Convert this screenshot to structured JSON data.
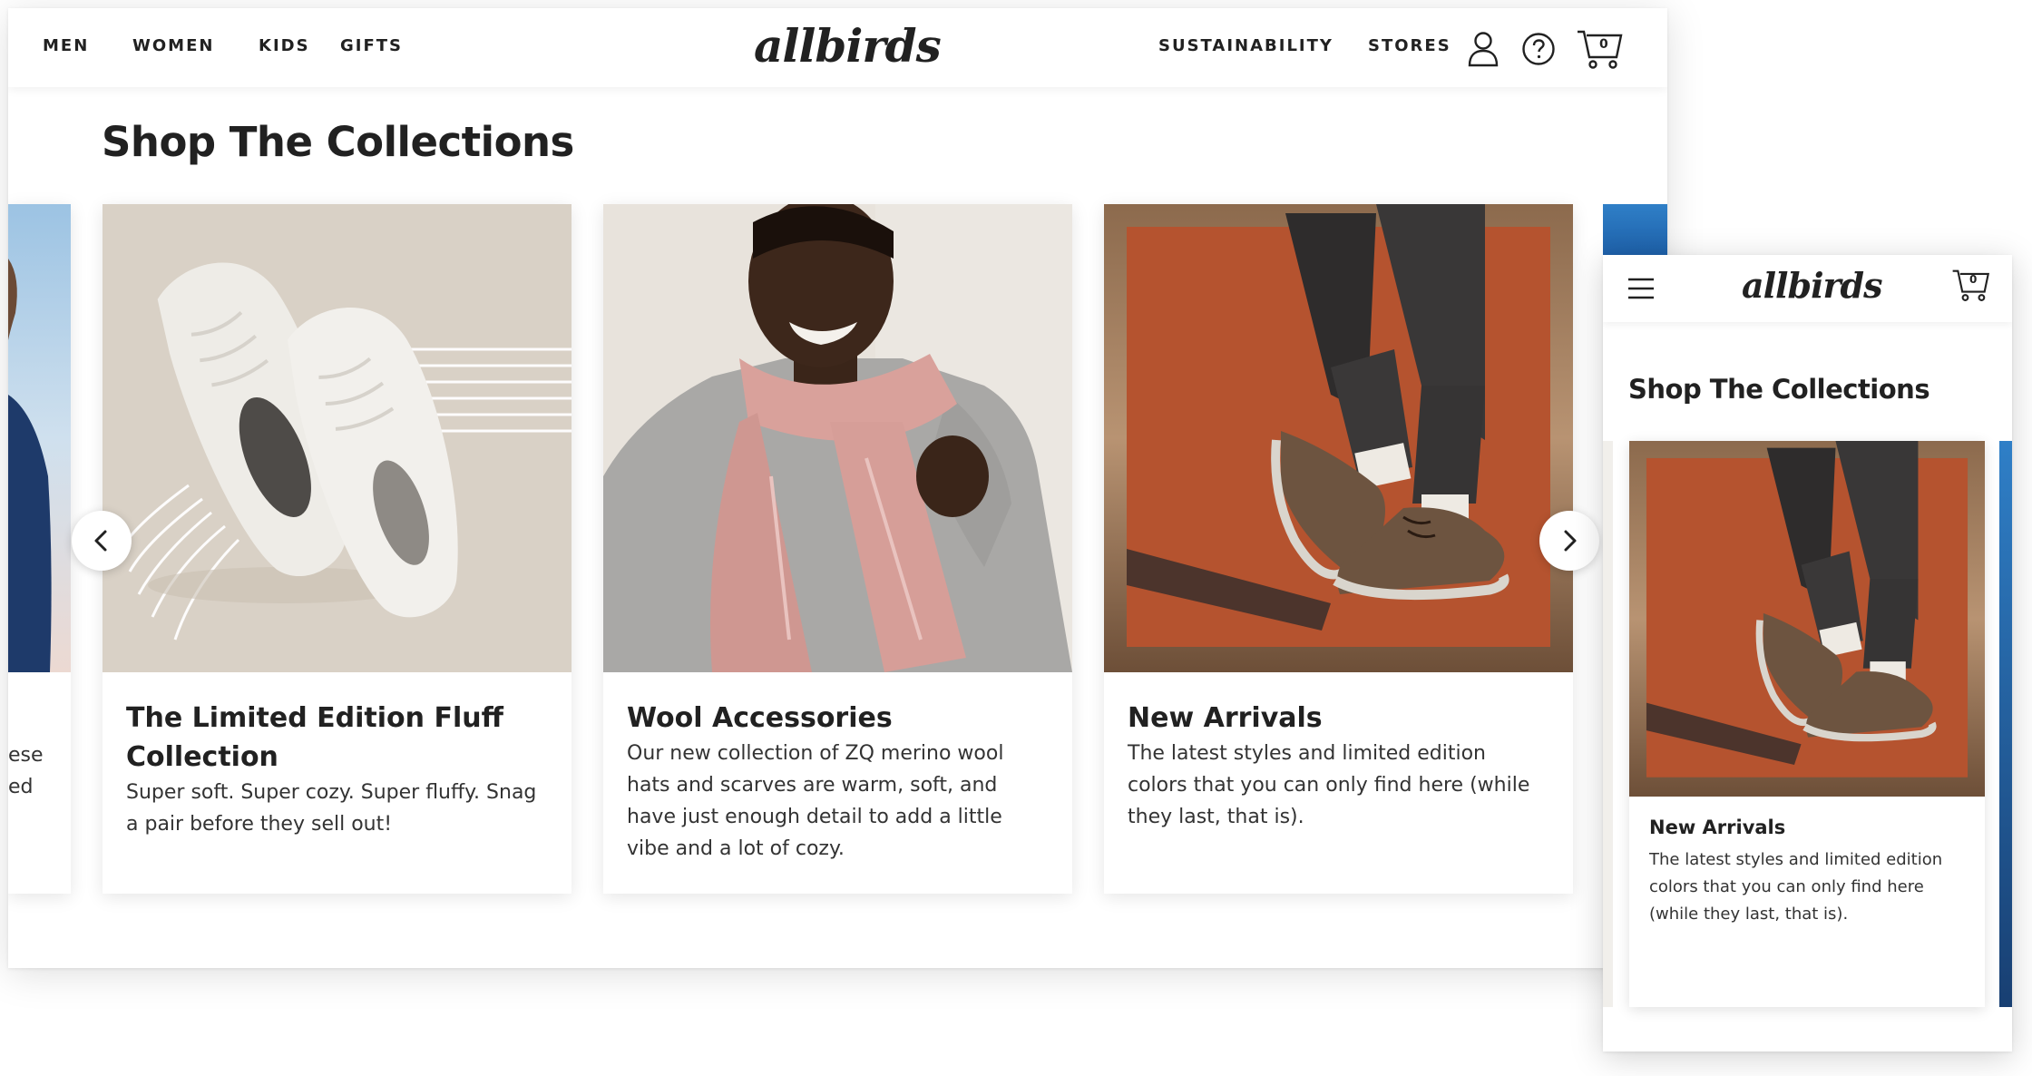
{
  "desktop": {
    "nav_left": [
      "MEN",
      "WOMEN",
      "KIDS",
      "GIFTS"
    ],
    "nav_right": [
      "SUSTAINABILITY",
      "STORES"
    ],
    "logo": "allbirds",
    "cart_count": "0",
    "heading": "Shop The Collections",
    "partial_text": [
      "ese",
      "ed"
    ],
    "cards": [
      {
        "title": "The Limited Edition Fluff Collection",
        "description": "Super soft. Super cozy. Super fluffy. Snag a pair before they sell out!"
      },
      {
        "title": "Wool Accessories",
        "description": "Our new collection of ZQ merino wool hats and scarves are warm, soft, and have just enough detail to add a little vibe and a lot of cozy."
      },
      {
        "title": "New Arrivals",
        "description": "The latest styles and limited edition colors that you can only find here (while they last, that is)."
      }
    ]
  },
  "mobile": {
    "logo": "allbirds",
    "cart_count": "0",
    "heading": "Shop The Collections",
    "card": {
      "title": "New Arrivals",
      "description": "The latest styles and limited edition colors that you can only find here (while they last, that is)."
    }
  },
  "colors": {
    "text": "#212121",
    "orange_backdrop": "#b5532f",
    "shoe_brown": "#6d5440",
    "wool_white": "#eeece7",
    "beige_bg": "#d9d1c6",
    "scarf_pink": "#d9a19b"
  },
  "icons": [
    "user-icon",
    "help-icon",
    "cart-icon",
    "hamburger-icon",
    "chevron-left-icon",
    "chevron-right-icon"
  ]
}
